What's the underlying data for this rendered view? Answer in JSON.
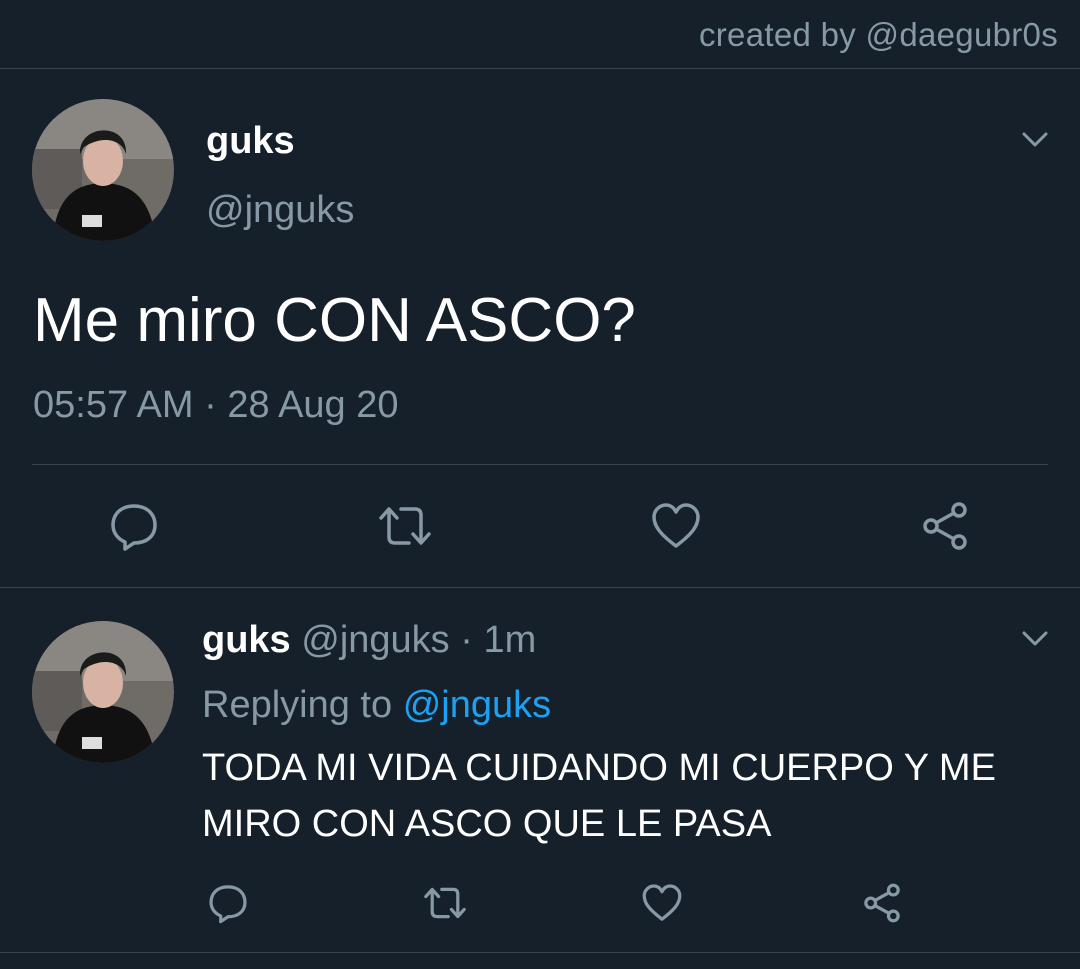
{
  "credit": "created by @daegubr0s",
  "main_tweet": {
    "name": "guks",
    "handle": "@jnguks",
    "text": "Me miro CON ASCO?",
    "time": "05:57 AM",
    "separator": "·",
    "date": "28 Aug 20",
    "icons": {
      "avatar": "profile-photo",
      "more": "chevron-down-icon",
      "reply": "reply-icon",
      "retweet": "retweet-icon",
      "like": "heart-icon",
      "share": "share-icon"
    }
  },
  "reply_tweet": {
    "name": "guks",
    "handle": "@jnguks",
    "separator": "·",
    "time": "1m",
    "replying_label": "Replying to",
    "replying_to": "@jnguks",
    "text": "TODA MI VIDA CUIDANDO MI CUERPO Y ME MIRO CON ASCO QUE LE PASA"
  },
  "colors": {
    "background": "#15202b",
    "divider": "#38444d",
    "secondary_text": "#8899a6",
    "accent": "#1da1f2"
  }
}
